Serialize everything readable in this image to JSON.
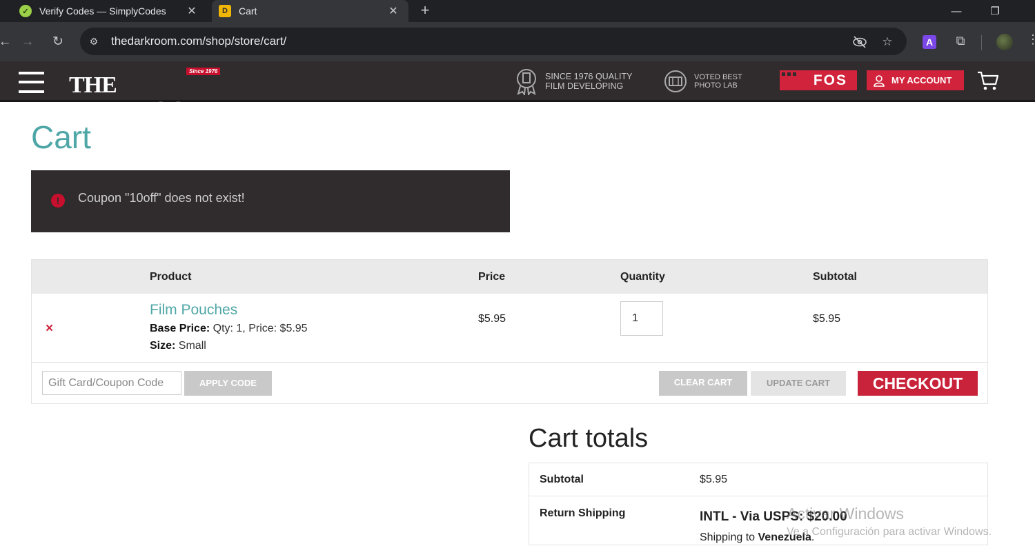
{
  "browser": {
    "tabs": [
      {
        "title": "Verify Codes — SimplyCodes",
        "favicon": "simplycodes-check-icon",
        "active": false
      },
      {
        "title": "Cart",
        "favicon": "darkroom-favicon",
        "active": true
      }
    ],
    "url": "thedarkroom.com/shop/store/cart/",
    "extension_label": "A"
  },
  "header": {
    "logo": {
      "since": "Since 1976",
      "word": "THE DARKROOM"
    },
    "badge1": {
      "line1": "SINCE 1976 QUALITY",
      "line2": "FILM DEVELOPING"
    },
    "badge2": {
      "line1": "VOTED BEST",
      "line2": "PHOTO LAB"
    },
    "fos_label": "FOS",
    "account_label": "MY ACCOUNT"
  },
  "page": {
    "title": "Cart",
    "notice": {
      "icon": "!",
      "text": "Coupon \"10off\" does not exist!"
    }
  },
  "cart": {
    "headers": {
      "product": "Product",
      "price": "Price",
      "quantity": "Quantity",
      "subtotal": "Subtotal"
    },
    "items": [
      {
        "remove": "×",
        "name": "Film Pouches",
        "base_price_label": "Base Price:",
        "base_price_value": "Qty: 1, Price: $5.95",
        "size_label": "Size:",
        "size_value": "Small",
        "price": "$5.95",
        "quantity": "1",
        "subtotal": "$5.95"
      }
    ],
    "coupon_placeholder": "Gift Card/Coupon Code",
    "apply_label": "APPLY CODE",
    "clear_label": "CLEAR CART",
    "update_label": "UPDATE CART",
    "checkout_label": "CHECKOUT"
  },
  "totals": {
    "title": "Cart totals",
    "subtotal_label": "Subtotal",
    "subtotal_value": "$5.95",
    "shipping_label": "Return Shipping",
    "shipping_method": "INTL - Via USPS: $20.00",
    "shipping_to_prefix": "Shipping to",
    "shipping_to_country": "Venezuela"
  },
  "watermark": {
    "line1": "Activar Windows",
    "line2": "Ve a Configuración para activar Windows."
  },
  "colors": {
    "accent_teal": "#4fa6a6",
    "brand_red": "#d1233b",
    "header_dark": "#302b2c"
  }
}
